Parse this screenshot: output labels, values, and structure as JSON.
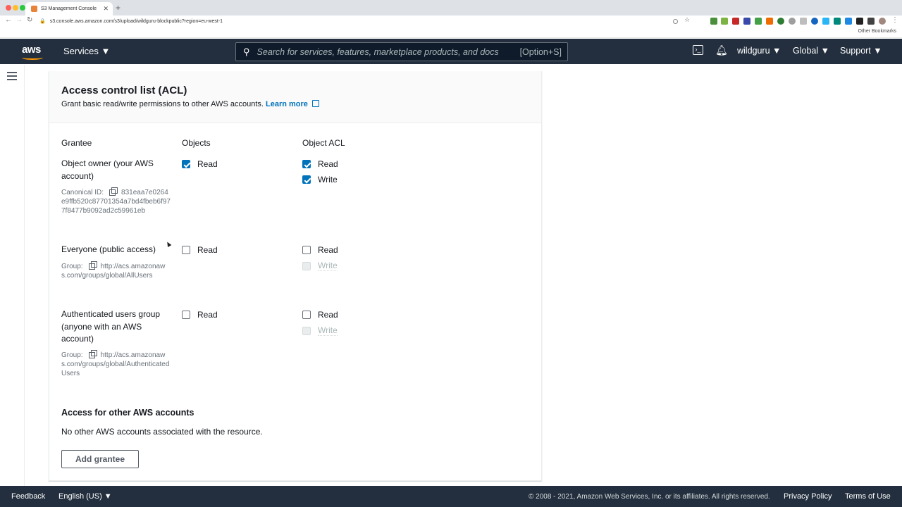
{
  "browser": {
    "tab_title": "S3 Management Console",
    "new_tab": "+",
    "url": "s3.console.aws.amazon.com/s3/upload/wildguru-blockpublic?region=eu-west-1",
    "other_bookmarks": "Other Bookmarks"
  },
  "aws_nav": {
    "logo": "aws",
    "services": "Services ▼",
    "search_placeholder": "Search for services, features, marketplace products, and docs",
    "search_shortcut": "[Option+S]",
    "account": "wildguru ▼",
    "region": "Global ▼",
    "support": "Support ▼"
  },
  "acl": {
    "title": "Access control list (ACL)",
    "description": "Grant basic read/write permissions to other AWS accounts.",
    "learn_more": "Learn more",
    "columns": [
      "Grantee",
      "Objects",
      "Object ACL"
    ],
    "grantees": [
      {
        "name": "Object owner (your AWS account)",
        "meta_label": "Canonical ID:",
        "meta_value": "831eaa7e0264e9ffb520c87701354a7bd4fbeb6f977f8477b9092ad2c59961eb",
        "objects": [
          {
            "label": "Read",
            "checked": true,
            "disabled": false
          }
        ],
        "object_acl": [
          {
            "label": "Read",
            "checked": true,
            "disabled": false
          },
          {
            "label": "Write",
            "checked": true,
            "disabled": false
          }
        ]
      },
      {
        "name": "Everyone (public access)",
        "meta_label": "Group:",
        "meta_value": "http://acs.amazonaws.com/groups/global/AllUsers",
        "objects": [
          {
            "label": "Read",
            "checked": false,
            "disabled": false
          }
        ],
        "object_acl": [
          {
            "label": "Read",
            "checked": false,
            "disabled": false
          },
          {
            "label": "Write",
            "checked": false,
            "disabled": true
          }
        ]
      },
      {
        "name": "Authenticated users group (anyone with an AWS account)",
        "meta_label": "Group:",
        "meta_value": "http://acs.amazonaws.com/groups/global/AuthenticatedUsers",
        "objects": [
          {
            "label": "Read",
            "checked": false,
            "disabled": false
          }
        ],
        "object_acl": [
          {
            "label": "Read",
            "checked": false,
            "disabled": false
          },
          {
            "label": "Write",
            "checked": false,
            "disabled": true
          }
        ]
      }
    ],
    "other_accounts_title": "Access for other AWS accounts",
    "other_accounts_desc": "No other AWS accounts associated with the resource.",
    "add_grantee": "Add grantee"
  },
  "footer": {
    "feedback": "Feedback",
    "language": "English (US) ▼",
    "copyright": "© 2008 - 2021, Amazon Web Services, Inc. or its affiliates. All rights reserved.",
    "privacy": "Privacy Policy",
    "terms": "Terms of Use"
  },
  "colors": {
    "nav_bg": "#232f3e",
    "accent": "#0073bb",
    "aws_orange": "#ff9900"
  }
}
